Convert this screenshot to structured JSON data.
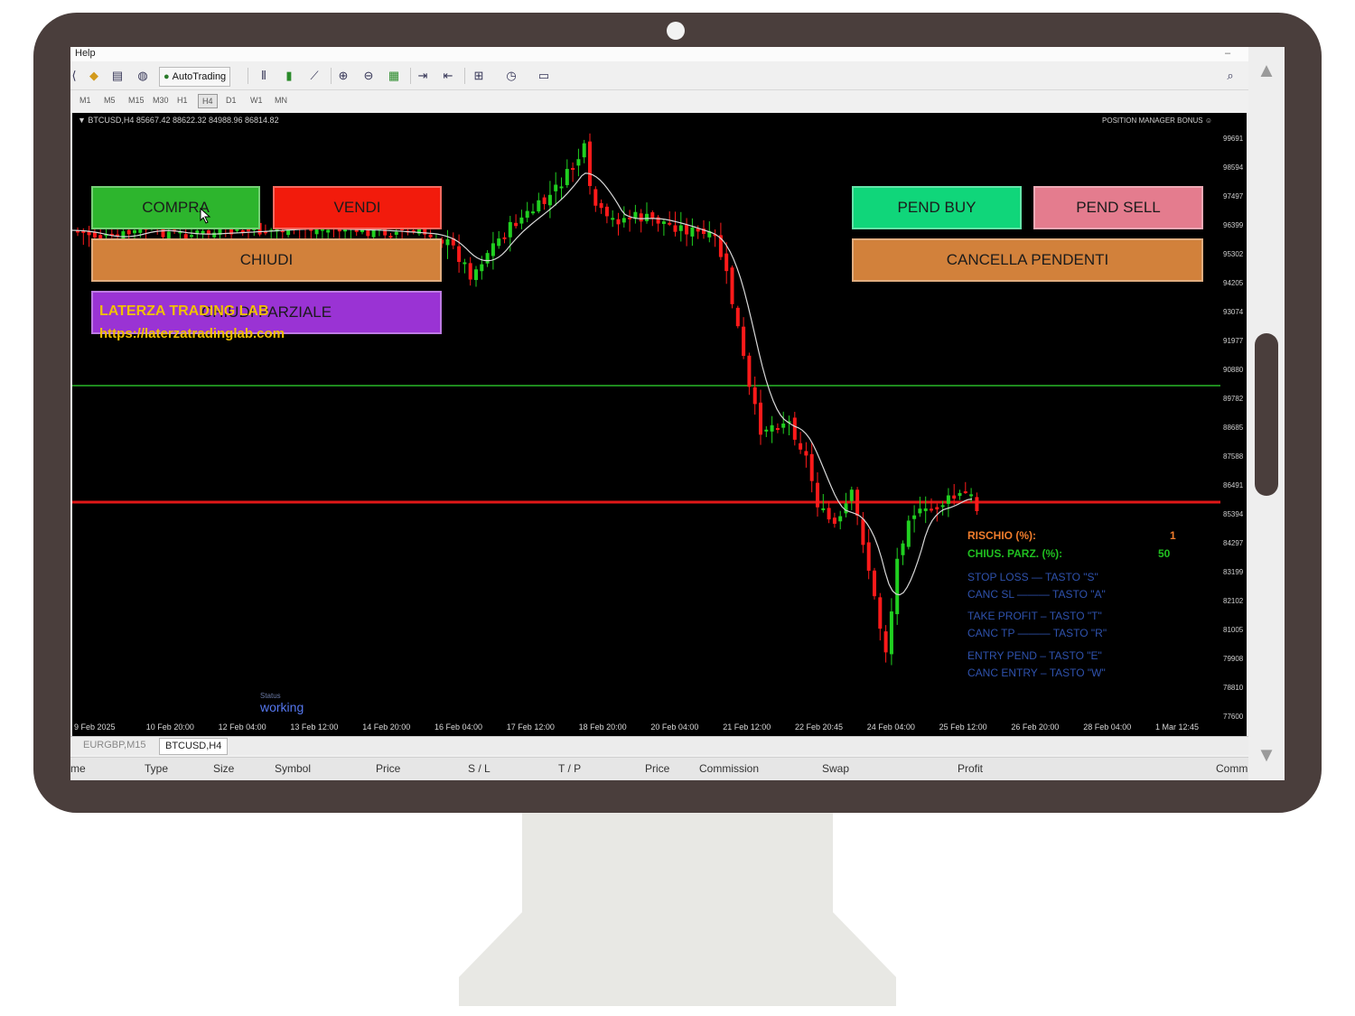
{
  "menu": {
    "help": "Help",
    "minimize": "–"
  },
  "toolbar": {
    "autotrading_label": "AutoTrading"
  },
  "timeframes": [
    "M1",
    "M5",
    "M15",
    "M30",
    "H1",
    "H4",
    "D1",
    "W1",
    "MN"
  ],
  "active_timeframe": "H4",
  "chart": {
    "symbol_info": "▼ BTCUSD,H4  85667.42 88622.32 84988.96 86814.82",
    "position_manager": "POSITION MANAGER BONUS ☺",
    "brand": "LATERZA TRADING LAB",
    "brand_url": "https://laterzatradinglab.com",
    "status_label": "Status",
    "status_value": "working"
  },
  "buttons": {
    "compra": "COMPRA",
    "vendi": "VENDI",
    "chiudi": "CHIUDI",
    "chiudi_parziale": "CHIUDI PARZIALE",
    "pend_buy": "PEND BUY",
    "pend_sell": "PEND SELL",
    "cancella_pendenti": "CANCELLA PENDENTI"
  },
  "colors": {
    "compra": "#2db52d",
    "vendi": "#f21b0c",
    "chiudi": "#d2813b",
    "chiudi_parziale": "#9a33d4",
    "pend_buy": "#10d67a",
    "pend_sell": "#e47c8e",
    "cancella_pendenti": "#d2813b",
    "bull": "#20d020",
    "bear": "#ff1a1a"
  },
  "panel": {
    "rischio_label": "RISCHIO (%):",
    "rischio_value": "1",
    "chius_label": "CHIUS. PARZ. (%):",
    "chius_value": "50",
    "hotkeys": [
      "STOP LOSS — TASTO \"S\"",
      "CANC SL ——— TASTO \"A\"",
      "TAKE PROFIT – TASTO \"T\"",
      "CANC TP ——— TASTO \"R\"",
      "ENTRY PEND – TASTO \"E\"",
      "CANC ENTRY – TASTO \"W\""
    ]
  },
  "date_axis": [
    "9 Feb 2025",
    "10 Feb 20:00",
    "12 Feb 04:00",
    "13 Feb 12:00",
    "14 Feb 20:00",
    "16 Feb 04:00",
    "17 Feb 12:00",
    "18 Feb 20:00",
    "20 Feb 04:00",
    "21 Feb 12:00",
    "22 Feb 20:45",
    "24 Feb 04:00",
    "25 Feb 12:00",
    "26 Feb 20:00",
    "28 Feb 04:00",
    "1 Mar 12:45"
  ],
  "price_axis": [
    "99691",
    "98594",
    "97497",
    "96399",
    "95302",
    "94205",
    "93074",
    "91977",
    "90880",
    "89782",
    "88685",
    "87588",
    "86491",
    "85394",
    "84297",
    "83199",
    "82102",
    "81005",
    "79908",
    "78810",
    "77600"
  ],
  "price_tags": {
    "current": "86814",
    "green_line": "89782",
    "red_line": "85600"
  },
  "tabs": [
    "EURGBP,M15",
    "BTCUSD,H4"
  ],
  "active_tab": "BTCUSD,H4",
  "terminal_columns": [
    "me",
    "Type",
    "Size",
    "Symbol",
    "Price",
    "S / L",
    "T / P",
    "Price",
    "Commission",
    "Swap",
    "Profit",
    "Comm"
  ]
}
